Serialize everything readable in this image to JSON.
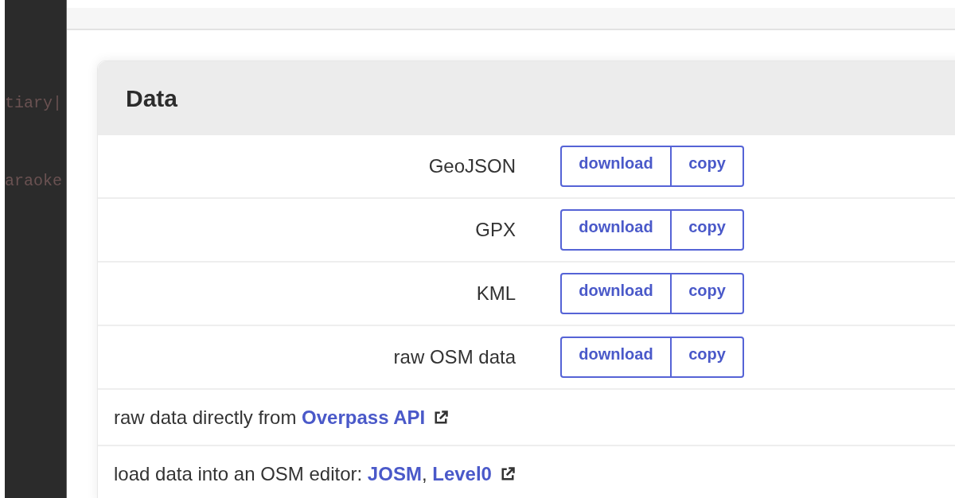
{
  "sidebar": {
    "code_lines": [
      "tiary|",
      "araoke"
    ]
  },
  "panel": {
    "title": "Data",
    "formats": [
      {
        "label": "GeoJSON",
        "actions": [
          "download",
          "copy"
        ]
      },
      {
        "label": "GPX",
        "actions": [
          "download",
          "copy"
        ]
      },
      {
        "label": "KML",
        "actions": [
          "download",
          "copy"
        ]
      },
      {
        "label": "raw OSM data",
        "actions": [
          "download",
          "copy"
        ]
      }
    ],
    "notes": [
      {
        "parts": [
          {
            "kind": "text",
            "text": "raw data directly from "
          },
          {
            "kind": "link",
            "text": "Overpass API"
          },
          {
            "kind": "external"
          }
        ]
      },
      {
        "parts": [
          {
            "kind": "text",
            "text": "load data into an OSM editor: "
          },
          {
            "kind": "link",
            "text": "JOSM"
          },
          {
            "kind": "text",
            "text": ", "
          },
          {
            "kind": "link",
            "text": "Level0"
          },
          {
            "kind": "external"
          }
        ]
      }
    ]
  }
}
